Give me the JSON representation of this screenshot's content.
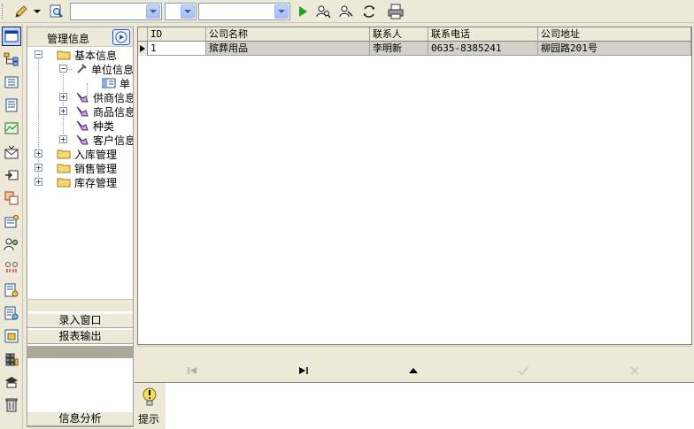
{
  "toolbar": {
    "combos": [
      {
        "name": "combo-1",
        "value": ""
      },
      {
        "name": "combo-2",
        "value": ""
      },
      {
        "name": "combo-3",
        "value": ""
      }
    ],
    "icons": [
      "pencil-icon",
      "chevron-down-icon",
      "find-icon",
      "run-icon",
      "search-user-icon",
      "search-user-2-icon",
      "refresh-icon",
      "print-icon"
    ]
  },
  "vbar": {
    "icons": [
      "window-icon",
      "tree-icon",
      "list-icon",
      "document-icon",
      "chart-icon",
      "mail-icon",
      "arrow-box-icon",
      "grid-icon",
      "settings-icon",
      "users-icon",
      "link-icon",
      "report-icon",
      "report-2-icon",
      "table-icon",
      "calendar-icon",
      "hat-icon",
      "trash-icon"
    ]
  },
  "nav": {
    "header": "管理信息",
    "tree": [
      {
        "label": "基本信息"
      },
      {
        "label": "单位信息"
      },
      {
        "label": "单"
      },
      {
        "label": "供商信息"
      },
      {
        "label": "商品信息"
      },
      {
        "label": "种类"
      },
      {
        "label": "客户信息"
      },
      {
        "label": "入库管理"
      },
      {
        "label": "销售管理"
      },
      {
        "label": "库存管理"
      }
    ],
    "tabs": {
      "entry": "录入窗口",
      "report": "报表输出",
      "analysis": "信息分析"
    }
  },
  "grid": {
    "columns": [
      "ID",
      "公司名称",
      "联系人",
      "联系电话",
      "公司地址"
    ],
    "rows": [
      [
        "1",
        "殡葬用品",
        "李明新",
        "0635-8385241",
        "柳园路201号"
      ]
    ]
  },
  "navigator": {
    "buttons": [
      "first",
      "last",
      "insert",
      "post",
      "cancel"
    ]
  },
  "hint": {
    "label": "提示"
  }
}
